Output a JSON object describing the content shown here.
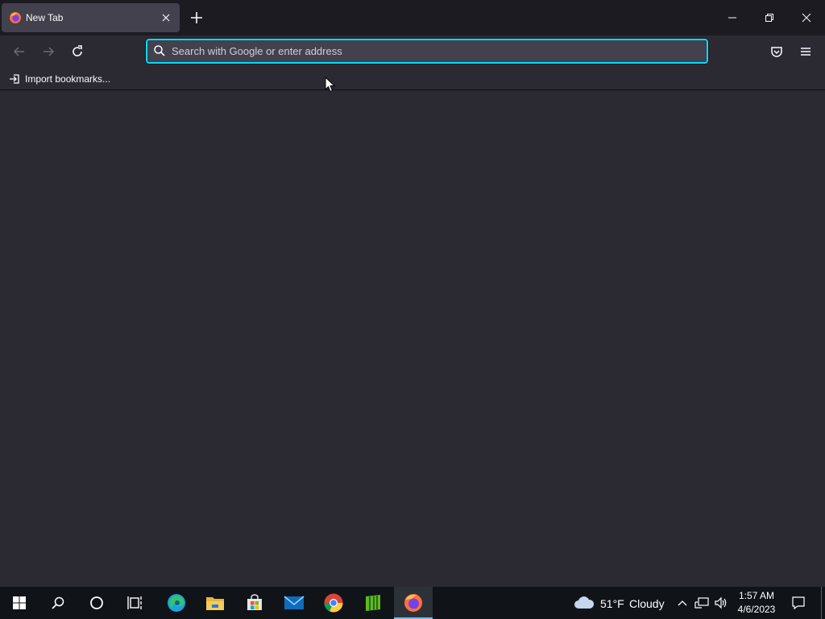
{
  "browser": {
    "tab": {
      "title": "New Tab"
    },
    "urlbar": {
      "placeholder": "Search with Google or enter address",
      "value": ""
    },
    "bookmarks": {
      "import_label": "Import bookmarks..."
    }
  },
  "taskbar": {
    "weather": {
      "temperature": "51°F",
      "condition": "Cloudy"
    },
    "clock": {
      "time": "1:57 AM",
      "date": "4/6/2023"
    }
  },
  "colors": {
    "titlebar": "#1c1b22",
    "toolbar": "#2b2a33",
    "tab_selected": "#42414d",
    "focus_ring": "#00ddff",
    "taskbar": "#101419"
  }
}
